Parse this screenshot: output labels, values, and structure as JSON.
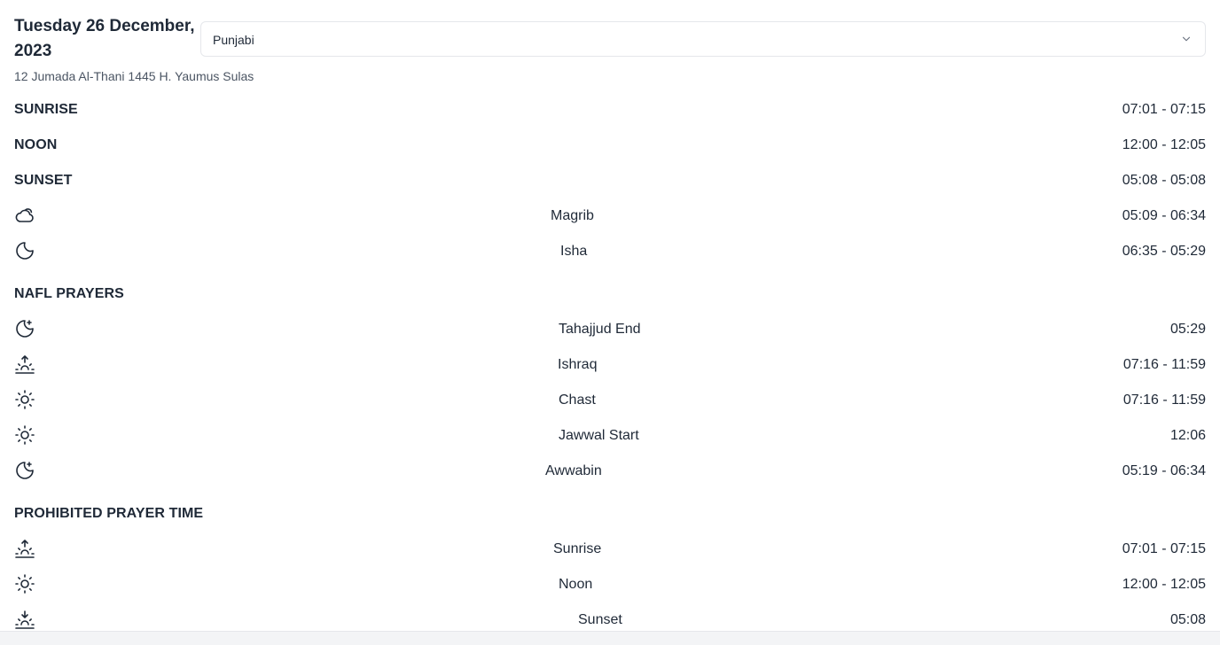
{
  "header": {
    "date": "Tuesday 26 December, 2023",
    "hijri": "12 Jumada Al-Thani 1445 H. Yaumus Sulas"
  },
  "language_select": {
    "value": "Punjabi",
    "icon": "chevron-down-icon"
  },
  "main_times": [
    {
      "label": "SUNRISE",
      "time": "07:01 - 07:15"
    },
    {
      "label": "NOON",
      "time": "12:00 - 12:05"
    },
    {
      "label": "SUNSET",
      "time": "05:08 - 05:08"
    }
  ],
  "evening_prayers": [
    {
      "name": "Magrib",
      "time": "05:09 - 06:34",
      "icon": "cloud-icon"
    },
    {
      "name": "Isha",
      "time": "06:35 - 05:29",
      "icon": "moon-icon"
    }
  ],
  "nafl": {
    "heading": "NAFL PRAYERS",
    "items": [
      {
        "name": "Tahajjud End",
        "time": "05:29",
        "icon": "moon-star-icon"
      },
      {
        "name": "Ishraq",
        "time": "07:16 - 11:59",
        "icon": "sunrise-icon"
      },
      {
        "name": "Chast",
        "time": "07:16 - 11:59",
        "icon": "sun-icon"
      },
      {
        "name": "Jawwal Start",
        "time": "12:06",
        "icon": "sun-icon"
      },
      {
        "name": "Awwabin",
        "time": "05:19 - 06:34",
        "icon": "moon-star-icon"
      }
    ]
  },
  "prohibited": {
    "heading": "PROHIBITED PRAYER TIME",
    "items": [
      {
        "name": "Sunrise",
        "time": "07:01 - 07:15",
        "icon": "sunrise-icon"
      },
      {
        "name": "Noon",
        "time": "12:00 - 12:05",
        "icon": "sun-icon"
      },
      {
        "name": "Sunset",
        "time": "05:08",
        "icon": "sunset-icon"
      }
    ]
  }
}
